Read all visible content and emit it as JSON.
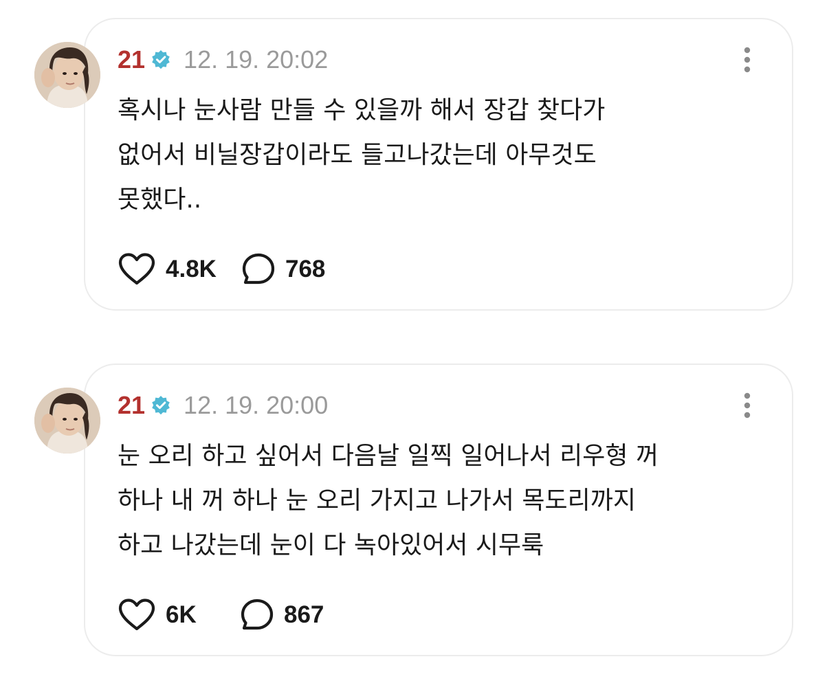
{
  "posts": [
    {
      "username": "21",
      "timestamp": "12. 19. 20:02",
      "lines": [
        "혹시나 눈사람 만들 수 있을까 해서 장갑 찾다가",
        "없어서 비닐장갑이라도 들고나갔는데 아무것도",
        "못했다.."
      ],
      "likes": "4.8K",
      "comments": "768"
    },
    {
      "username": "21",
      "timestamp": "12. 19. 20:00",
      "lines": [
        "눈 오리 하고 싶어서 다음날 일찍 일어나서 리우형 꺼",
        "하나 내 꺼 하나 눈 오리 가지고 나가서 목도리까지",
        "하고 나갔는데 눈이 다 녹아있어서 시무룩"
      ],
      "likes": "6K",
      "comments": "867"
    }
  ],
  "colors": {
    "username": "#b3312e",
    "verified_badge": "#4fb8d4",
    "timestamp": "#9a9a9a",
    "text": "#1a1a1a",
    "card_border": "#ececec"
  },
  "icons": {
    "verified": "verified-badge-icon",
    "more": "more-vertical-icon",
    "like": "heart-icon",
    "comment": "comment-bubble-icon"
  }
}
